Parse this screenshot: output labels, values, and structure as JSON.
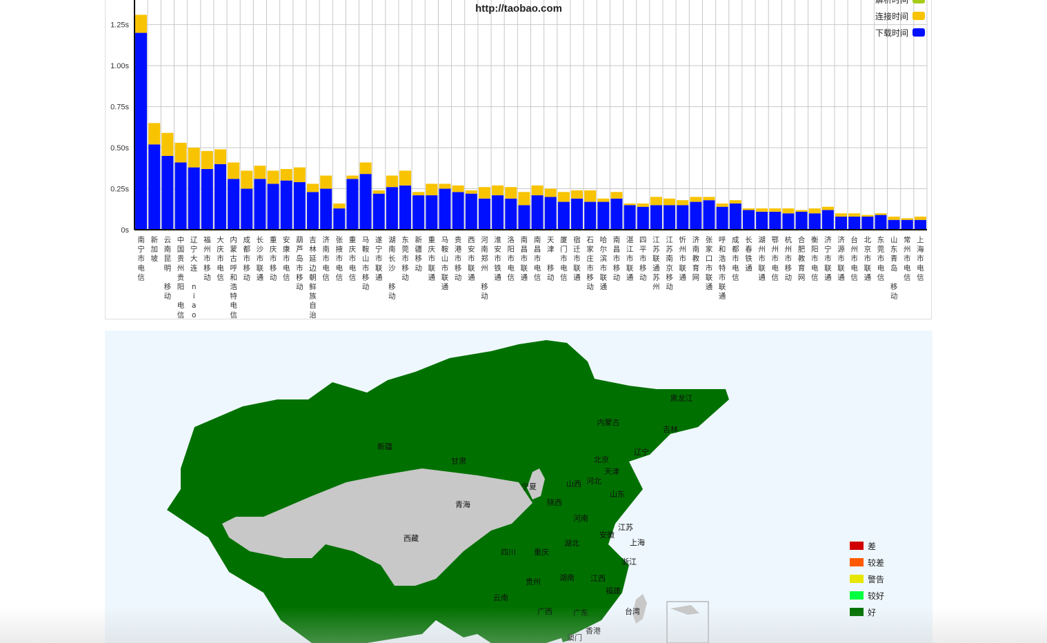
{
  "chart_data": {
    "type": "bar",
    "stacked": true,
    "title": "http://taobao.com",
    "ylim": [
      0,
      1.4
    ],
    "yticks": [
      "0s",
      "0.25s",
      "0.50s",
      "0.75s",
      "1.00s",
      "1.25s"
    ],
    "ytick_values": [
      0,
      0.25,
      0.5,
      0.75,
      1.0,
      1.25
    ],
    "grid": true,
    "legend_position": "top-right",
    "categories": [
      "南宁市电信",
      "新加坡",
      "云南昆明 移动",
      "中国贵州贵阳 电信",
      "辽宁大连 niao",
      "福州市移动",
      "大庆市电信",
      "内蒙古呼和浩特电信",
      "成都市移动",
      "长沙市联通",
      "重庆市移动",
      "安康市电信",
      "葫芦岛市移动",
      "吉林延边朝鲜族自治",
      "济南市电信",
      "张掖市电信",
      "重庆市电信",
      "马鞍山市移动",
      "遂宁市联通",
      "湖南长沙 移动",
      "东莞市移动",
      "新疆移动",
      "重庆市联通",
      "马鞍山市联通",
      "贵港市移动",
      "西安市联通",
      "河南郑州 移动",
      "淮安市铁通",
      "洛阳市电信",
      "南昌市联通",
      "南昌市电信",
      "天津 移动",
      "厦门市电信",
      "宿迁市联通",
      "石家庄市移动",
      "哈尔滨市联通",
      "南昌市移动",
      "湛江市联通",
      "四平市移动",
      "江苏联通苏州",
      "江苏南京移动",
      "忻州市联通",
      "济南教育网",
      "张家口市联通",
      "呼和浩特市联通",
      "成都市电信",
      "长春铁通",
      "湖州市联通",
      "鄂州市电信",
      "杭州市移动",
      "合肥教育网",
      "衡阳市电信",
      "济宁市联通",
      "济源市联通",
      "台州市电信",
      "北京市联通",
      "东莞市电信",
      "山东青岛 移动",
      "常州市电信",
      "上海市电信"
    ],
    "series": [
      {
        "name": "解析时间",
        "color": "#a6cc1a",
        "values": [
          0,
          0,
          0,
          0,
          0,
          0,
          0,
          0,
          0,
          0,
          0,
          0,
          0,
          0,
          0,
          0,
          0,
          0,
          0,
          0,
          0,
          0,
          0,
          0,
          0,
          0,
          0,
          0,
          0,
          0,
          0,
          0,
          0,
          0,
          0,
          0,
          0,
          0,
          0,
          0,
          0,
          0,
          0,
          0,
          0,
          0,
          0,
          0,
          0,
          0,
          0,
          0,
          0,
          0,
          0,
          0,
          0,
          0,
          0,
          0
        ]
      },
      {
        "name": "连接时间",
        "color": "#f8c300",
        "values": [
          0.11,
          0.13,
          0.14,
          0.12,
          0.12,
          0.11,
          0.09,
          0.1,
          0.11,
          0.08,
          0.08,
          0.07,
          0.09,
          0.05,
          0.08,
          0.03,
          0.02,
          0.07,
          0.02,
          0.07,
          0.09,
          0.02,
          0.07,
          0.03,
          0.04,
          0.02,
          0.07,
          0.06,
          0.07,
          0.08,
          0.06,
          0.05,
          0.06,
          0.05,
          0.07,
          0.02,
          0.04,
          0.01,
          0.02,
          0.05,
          0.04,
          0.03,
          0.03,
          0.02,
          0.02,
          0.02,
          0.01,
          0.02,
          0.02,
          0.03,
          0.01,
          0.03,
          0.02,
          0.02,
          0.02,
          0.01,
          0.01,
          0.02,
          0.01,
          0.02
        ]
      },
      {
        "name": "下载时间",
        "color": "#0010ff",
        "values": [
          1.2,
          0.52,
          0.45,
          0.41,
          0.38,
          0.37,
          0.4,
          0.31,
          0.25,
          0.31,
          0.28,
          0.3,
          0.29,
          0.23,
          0.25,
          0.13,
          0.31,
          0.34,
          0.22,
          0.26,
          0.27,
          0.21,
          0.21,
          0.25,
          0.23,
          0.22,
          0.19,
          0.21,
          0.19,
          0.15,
          0.21,
          0.2,
          0.17,
          0.19,
          0.17,
          0.17,
          0.19,
          0.15,
          0.14,
          0.15,
          0.15,
          0.15,
          0.17,
          0.18,
          0.14,
          0.16,
          0.12,
          0.11,
          0.11,
          0.1,
          0.11,
          0.1,
          0.12,
          0.08,
          0.08,
          0.08,
          0.09,
          0.06,
          0.06,
          0.06
        ]
      }
    ]
  },
  "map": {
    "colors": {
      "good": "#007100",
      "nodata": "#c8c8c8"
    },
    "provinces": [
      {
        "name": "新疆",
        "status": "good"
      },
      {
        "name": "甘肃",
        "status": "good"
      },
      {
        "name": "青海",
        "status": "nodata"
      },
      {
        "name": "西藏",
        "status": "nodata"
      },
      {
        "name": "宁夏",
        "status": "nodata"
      },
      {
        "name": "内蒙古",
        "status": "good"
      },
      {
        "name": "黑龙江",
        "status": "good"
      },
      {
        "name": "吉林",
        "status": "good"
      },
      {
        "name": "辽宁",
        "status": "good"
      },
      {
        "name": "北京",
        "status": "good"
      },
      {
        "name": "天津",
        "status": "good"
      },
      {
        "name": "河北",
        "status": "good"
      },
      {
        "name": "山西",
        "status": "good"
      },
      {
        "name": "山东",
        "status": "good"
      },
      {
        "name": "陕西",
        "status": "good"
      },
      {
        "name": "河南",
        "status": "good"
      },
      {
        "name": "江苏",
        "status": "good"
      },
      {
        "name": "安徽",
        "status": "good"
      },
      {
        "name": "上海",
        "status": "good"
      },
      {
        "name": "四川",
        "status": "good"
      },
      {
        "name": "重庆",
        "status": "good"
      },
      {
        "name": "湖北",
        "status": "good"
      },
      {
        "name": "浙江",
        "status": "good"
      },
      {
        "name": "贵州",
        "status": "good"
      },
      {
        "name": "湖南",
        "status": "good"
      },
      {
        "name": "江西",
        "status": "good"
      },
      {
        "name": "福建",
        "status": "good"
      },
      {
        "name": "云南",
        "status": "good"
      },
      {
        "name": "广西",
        "status": "good"
      },
      {
        "name": "广东",
        "status": "good"
      },
      {
        "name": "台湾",
        "status": "nodata"
      },
      {
        "name": "香港",
        "status": "good"
      },
      {
        "name": "澳门",
        "status": "good"
      }
    ],
    "legend": [
      {
        "label": "差",
        "color": "#d10000"
      },
      {
        "label": "较差",
        "color": "#ff5a00"
      },
      {
        "label": "警告",
        "color": "#e6e600"
      },
      {
        "label": "较好",
        "color": "#00ff40"
      },
      {
        "label": "好",
        "color": "#007100"
      }
    ]
  }
}
